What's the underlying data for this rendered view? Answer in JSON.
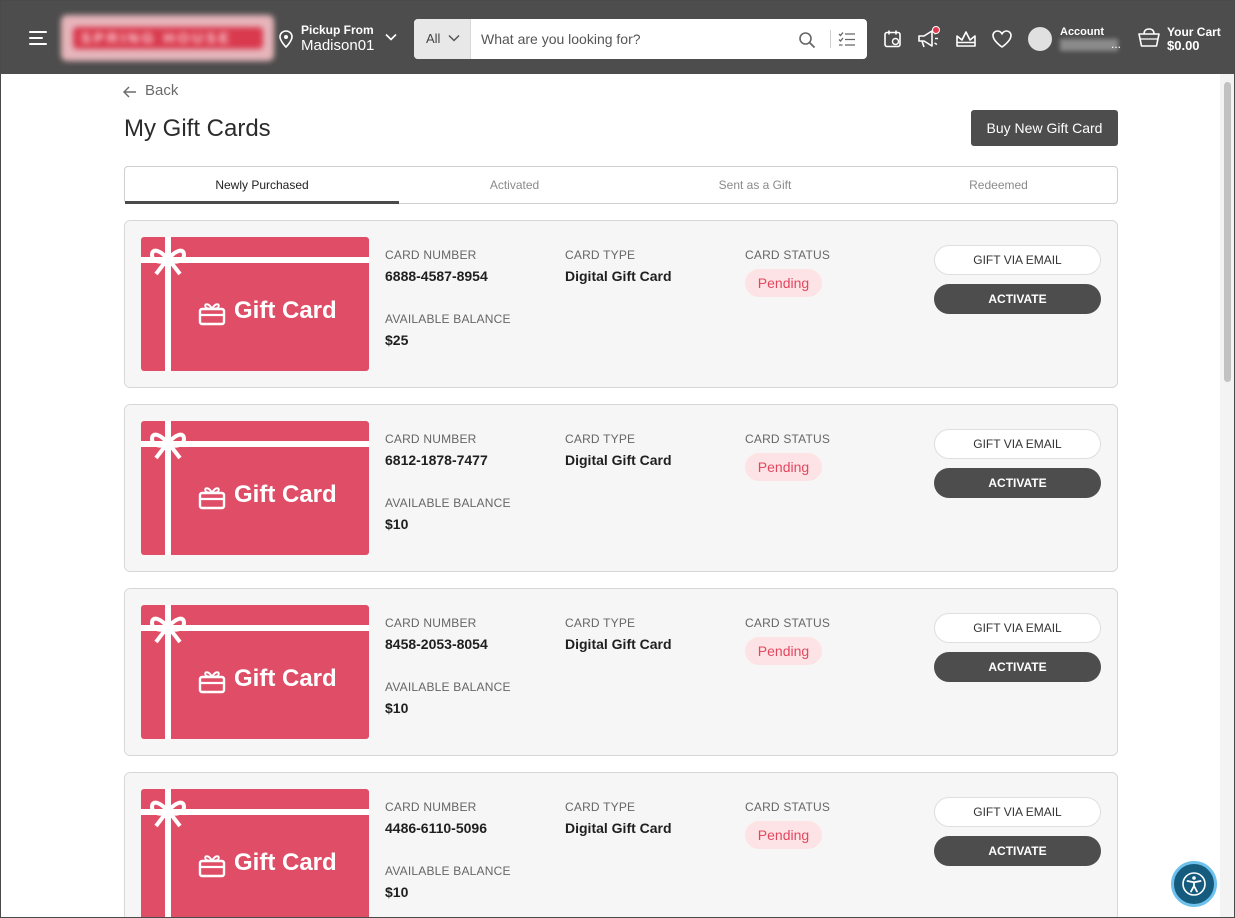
{
  "header": {
    "logo_text": "SPRING HOUSE",
    "pickup_label": "Pickup From",
    "pickup_value": "Madison01",
    "search_category": "All",
    "search_placeholder": "What are you looking for?",
    "account_label": "Account",
    "account_ellipsis": "...",
    "cart_label": "Your Cart",
    "cart_total": "$0.00",
    "icons": [
      "menu-icon",
      "location-pin-icon",
      "chevron-down-icon",
      "search-icon",
      "list-icon",
      "calendar-icon",
      "megaphone-icon",
      "crown-icon",
      "heart-icon",
      "cart-icon"
    ]
  },
  "page": {
    "back_label": "Back",
    "title": "My Gift Cards",
    "buy_button": "Buy New Gift Card"
  },
  "tabs": [
    {
      "label": "Newly Purchased",
      "active": true
    },
    {
      "label": "Activated",
      "active": false
    },
    {
      "label": "Sent as a Gift",
      "active": false
    },
    {
      "label": "Redeemed",
      "active": false
    }
  ],
  "labels": {
    "card_number": "CARD NUMBER",
    "card_type": "CARD TYPE",
    "card_status": "CARD STATUS",
    "available_balance": "AVAILABLE BALANCE",
    "gift_email": "GIFT VIA EMAIL",
    "activate": "ACTIVATE",
    "gift_card_text": "Gift Card"
  },
  "cards": [
    {
      "number": "6888-4587-8954",
      "type": "Digital Gift Card",
      "status": "Pending",
      "balance": "$25"
    },
    {
      "number": "6812-1878-7477",
      "type": "Digital Gift Card",
      "status": "Pending",
      "balance": "$10"
    },
    {
      "number": "8458-2053-8054",
      "type": "Digital Gift Card",
      "status": "Pending",
      "balance": "$10"
    },
    {
      "number": "4486-6110-5096",
      "type": "Digital Gift Card",
      "status": "Pending",
      "balance": "$10"
    }
  ],
  "colors": {
    "header_bg": "#4d4d4d",
    "gift_card": "#e04d67",
    "status_bg": "#fde3e5",
    "status_text": "#e0485f",
    "accessibility": "#145b7d"
  }
}
